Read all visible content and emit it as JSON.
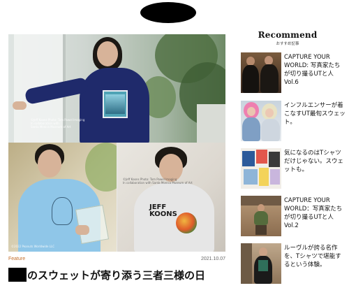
{
  "hero": {
    "credit_top": "©Jeff Koons Photo: Tom Powel Imaging\nIn collaboration with\nSanta Monica Museum of Art",
    "credit_bottom_left": "©2022 Peanuts Worldwide LLC",
    "credit_bottom_right": "©Jeff Koons  Photo: Tom Powel Imaging\nIn collaboration with Santa Monica Museum of Art",
    "shirt_text": "JEFF\nKOONS"
  },
  "article": {
    "category": "Feature",
    "date": "2021.10.07",
    "headline": "のスウェットが寄り添う三者三様の日"
  },
  "recommend": {
    "title": "Recommend",
    "subtitle": "おすすめ記事",
    "items": [
      {
        "title": "CAPTURE YOUR WORLD: 写真家たちが切り撮るUTと人 Vol.6"
      },
      {
        "title": "インフルエンサーが着こなすUT最旬スウェット。"
      },
      {
        "title": "気になるのはTシャツだけじゃない。スウェットも。"
      },
      {
        "title": "CAPTURE YOUR WORLD：写真家たちが切り撮るUTと人 Vol.2"
      },
      {
        "title": "ルーヴルが誇る名作を、Tシャツで堪能するという体験。"
      }
    ]
  },
  "colors": {
    "category": "#c46e2a",
    "sweat_navy": "#1f2a6b",
    "sweat_light_blue": "#8fc6e8",
    "sweat_gray": "#e6e6e6"
  }
}
